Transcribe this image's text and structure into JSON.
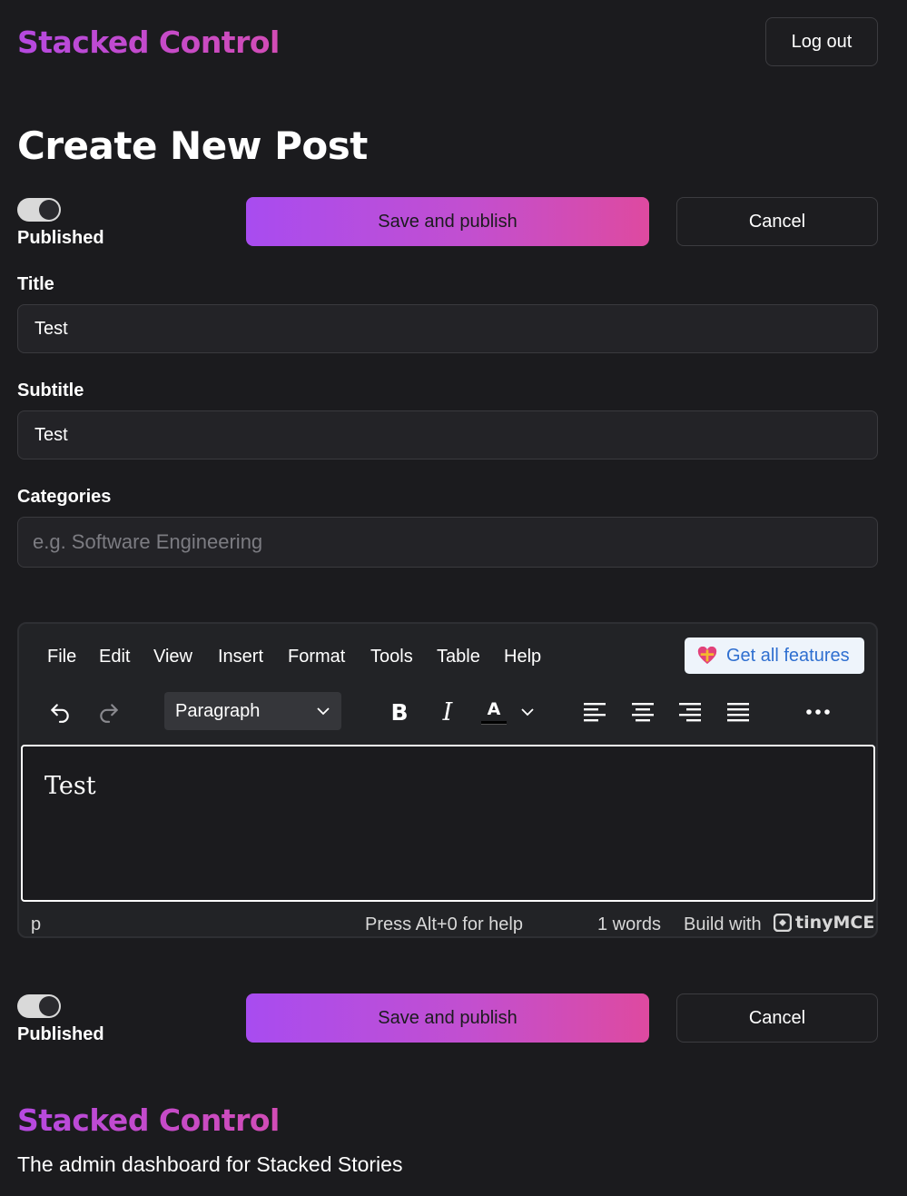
{
  "header": {
    "brand": "Stacked Control",
    "logout_label": "Log out"
  },
  "page_title": "Create New Post",
  "top_actions": {
    "published_label": "Published",
    "published_on": true,
    "save_label": "Save and publish",
    "cancel_label": "Cancel"
  },
  "form": {
    "title_label": "Title",
    "title_value": "Test",
    "subtitle_label": "Subtitle",
    "subtitle_value": "Test",
    "categories_label": "Categories",
    "categories_placeholder": "e.g. Software Engineering"
  },
  "editor": {
    "menu": [
      "File",
      "Edit",
      "View",
      "Insert",
      "Format",
      "Tools",
      "Table",
      "Help"
    ],
    "promo_label": "Get all features",
    "block_format": "Paragraph",
    "toolbar_icons": [
      "undo-icon",
      "redo-icon",
      "bold-icon",
      "italic-icon",
      "text-color-icon",
      "align-left-icon",
      "align-center-icon",
      "align-right-icon",
      "justify-icon",
      "more-icon"
    ],
    "content": "Test",
    "status_path": "p",
    "help_hint": "Press Alt+0 for help",
    "word_count": "1 words",
    "build_with": "Build with",
    "brand": "tinyMCE"
  },
  "bottom_actions": {
    "published_label": "Published",
    "published_on": true,
    "save_label": "Save and publish",
    "cancel_label": "Cancel"
  },
  "footer": {
    "brand": "Stacked Control",
    "tagline": "The admin dashboard for Stacked Stories"
  },
  "colors": {
    "background": "#1b1b1e",
    "accent_start": "#a84cf0",
    "accent_end": "#de4aa0",
    "brand": "#c14ad8"
  }
}
